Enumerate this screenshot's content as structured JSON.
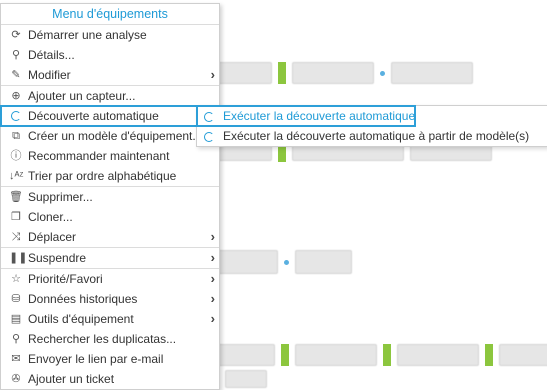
{
  "menu": {
    "title": "Menu d'équipements",
    "items": [
      {
        "label": "Démarrer une analyse",
        "icon": "refresh-icon",
        "submenu": false
      },
      {
        "label": "Détails...",
        "icon": "search-icon",
        "submenu": false
      },
      {
        "label": "Modifier",
        "icon": "edit-icon",
        "submenu": true
      },
      {
        "label": "Ajouter un capteur...",
        "icon": "plus-circle-icon",
        "submenu": false
      },
      {
        "label": "Découverte automatique",
        "icon": "spinner-icon",
        "submenu": true
      },
      {
        "label": "Créer un modèle d'équipement...",
        "icon": "template-icon",
        "submenu": false
      },
      {
        "label": "Recommander maintenant",
        "icon": "info-icon",
        "submenu": false
      },
      {
        "label": "Trier par ordre alphabétique",
        "icon": "sort-alpha-icon",
        "submenu": false
      },
      {
        "label": "Supprimer...",
        "icon": "trash-icon",
        "submenu": false
      },
      {
        "label": "Cloner...",
        "icon": "clone-icon",
        "submenu": false
      },
      {
        "label": "Déplacer",
        "icon": "shuffle-icon",
        "submenu": true
      },
      {
        "label": "Suspendre",
        "icon": "pause-icon",
        "submenu": true
      },
      {
        "label": "Priorité/Favori",
        "icon": "star-icon",
        "submenu": true
      },
      {
        "label": "Données historiques",
        "icon": "database-icon",
        "submenu": true
      },
      {
        "label": "Outils d'équipement",
        "icon": "briefcase-icon",
        "submenu": true
      },
      {
        "label": "Rechercher les duplicatas...",
        "icon": "search-icon",
        "submenu": false
      },
      {
        "label": "Envoyer le lien par e-mail",
        "icon": "envelope-icon",
        "submenu": false
      },
      {
        "label": "Ajouter un ticket",
        "icon": "ticket-icon",
        "submenu": false
      }
    ]
  },
  "submenu": {
    "items": [
      {
        "label": "Exécuter la découverte automatique"
      },
      {
        "label": "Exécuter la découverte automatique à partir de modèle(s)"
      }
    ]
  },
  "colors": {
    "accent": "#1e9ad6",
    "status_green": "#8cc63e"
  }
}
